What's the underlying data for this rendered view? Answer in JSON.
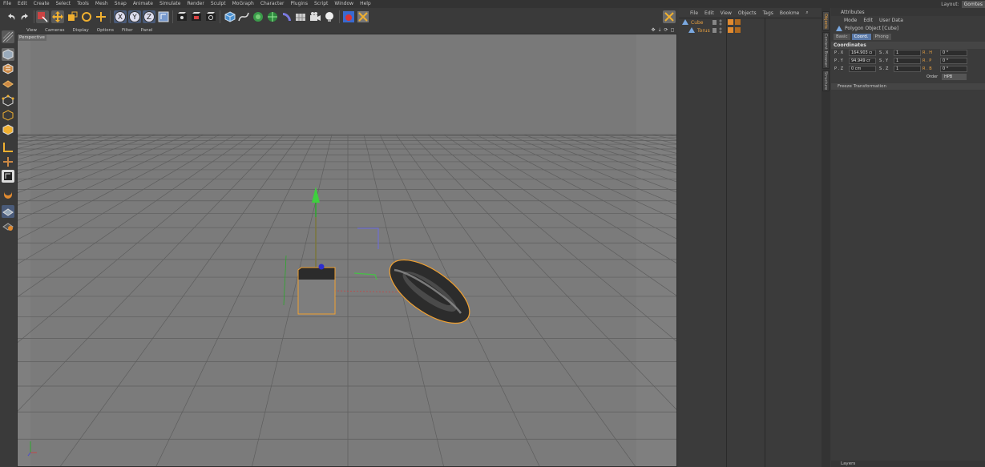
{
  "menubar": {
    "items": [
      "File",
      "Edit",
      "Create",
      "Select",
      "Tools",
      "Mesh",
      "Snap",
      "Animate",
      "Simulate",
      "Render",
      "Sculpt",
      "MoGraph",
      "Character",
      "Plugins",
      "Script",
      "Window",
      "Help"
    ],
    "layout_label": "Layout:",
    "layout_value": "Gomtes"
  },
  "toolbar": {
    "axis_labels": [
      "X",
      "Y",
      "Z"
    ]
  },
  "viewport": {
    "menu": [
      "View",
      "Cameras",
      "Display",
      "Options",
      "Filter",
      "Panel"
    ],
    "label": "Perspective"
  },
  "object_manager": {
    "menu": [
      "File",
      "Edit",
      "View",
      "Objects",
      "Tags",
      "Bookme"
    ],
    "objects": [
      {
        "name": "Cube",
        "selected": true
      },
      {
        "name": "Torus",
        "selected": true
      }
    ]
  },
  "side_tabs": [
    "Objects",
    "Content Browser",
    "Structure"
  ],
  "attributes": {
    "title": "Attributes",
    "menu": [
      "Mode",
      "Edit",
      "User Data"
    ],
    "object_label": "Polygon Object [Cube]",
    "tabs": [
      "Basic",
      "Coord.",
      "Phong"
    ],
    "active_tab": "Coord.",
    "section": "Coordinates",
    "rows": [
      {
        "p_label": "P . X",
        "p_val": "164.903 cı",
        "s_label": "S . X",
        "s_val": "1",
        "r_label": "R . H",
        "r_val": "0 °"
      },
      {
        "p_label": "P . Y",
        "p_val": "94.949 cr",
        "s_label": "S . Y",
        "s_val": "1",
        "r_label": "R . P",
        "r_val": "0 °"
      },
      {
        "p_label": "P . Z",
        "p_val": "0 cm",
        "s_label": "S . Z",
        "s_val": "1",
        "r_label": "R . B",
        "r_val": "0 °"
      }
    ],
    "order_label": "Order",
    "order_value": "HPB",
    "freeze": "Freeze Transformation",
    "layers": "Layers"
  },
  "colors": {
    "selection": "#e8a040",
    "active_tab": "#5a79a8",
    "viewport_bg": "#7b7b7b"
  }
}
